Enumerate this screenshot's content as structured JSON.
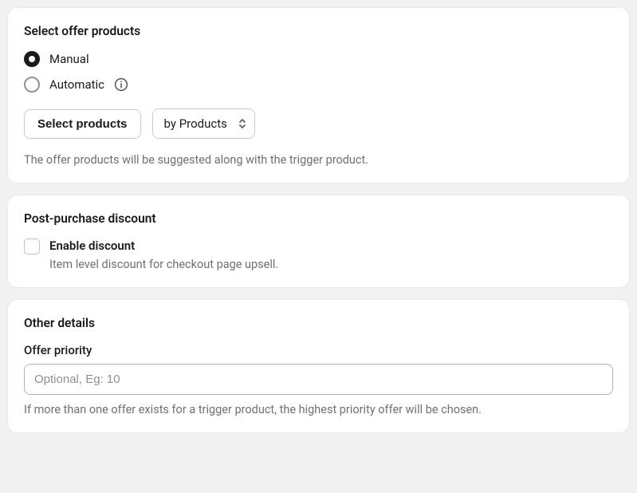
{
  "offerProducts": {
    "title": "Select offer products",
    "radioOptions": {
      "manual": "Manual",
      "automatic": "Automatic"
    },
    "selectProductsButton": "Select products",
    "byProductsSelect": "by Products",
    "helpText": "The offer products will be suggested along with the trigger product."
  },
  "postPurchase": {
    "title": "Post-purchase discount",
    "enableLabel": "Enable discount",
    "enableSub": "Item level discount for checkout page upsell."
  },
  "otherDetails": {
    "title": "Other details",
    "priorityLabel": "Offer priority",
    "priorityPlaceholder": "Optional, Eg: 10",
    "priorityHelp": "If more than one offer exists for a trigger product, the highest priority offer will be chosen."
  }
}
